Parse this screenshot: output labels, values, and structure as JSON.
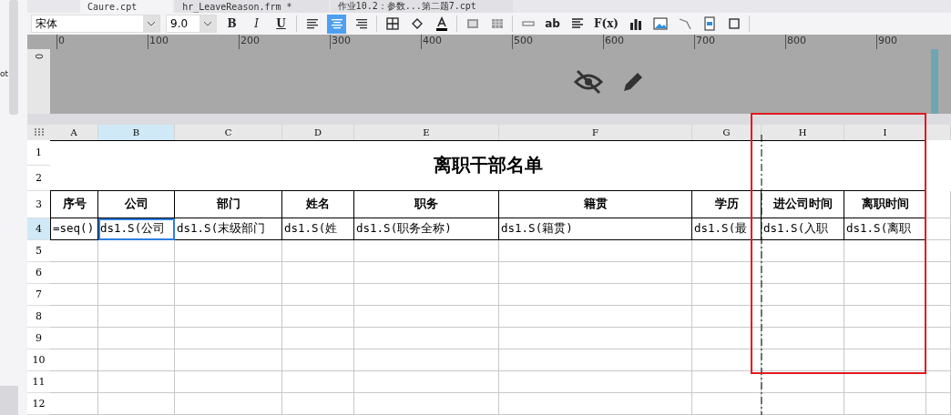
{
  "side_panel": {
    "label": "ot"
  },
  "tabs": [
    {
      "label": "Caure.cpt",
      "selected": true
    },
    {
      "label": "hr_LeaveReason.frm *",
      "selected": false
    },
    {
      "label": "作业10.2：参数...第二题7.cpt",
      "selected": false
    }
  ],
  "toolbar": {
    "font": "宋体",
    "size": "9.0",
    "styles": [
      "B",
      "I",
      "U"
    ],
    "align": [
      {
        "selected": false
      },
      {
        "selected": true
      },
      {
        "selected": false
      }
    ],
    "text_tools": [
      "ab",
      "F(x)"
    ]
  },
  "ruler": {
    "marks": [
      "0",
      "100",
      "200",
      "300",
      "400",
      "500",
      "600",
      "700",
      "800",
      "900"
    ],
    "vertical_mark": "0"
  },
  "sheet": {
    "columns": [
      {
        "label": "A",
        "selected": false
      },
      {
        "label": "B",
        "selected": true
      },
      {
        "label": "C",
        "selected": false
      },
      {
        "label": "D",
        "selected": false
      },
      {
        "label": "E",
        "selected": false
      },
      {
        "label": "F",
        "selected": false
      },
      {
        "label": "G",
        "selected": false
      },
      {
        "label": "H",
        "selected": false
      },
      {
        "label": "I",
        "selected": false
      }
    ],
    "rows": [
      {
        "label": "1",
        "selected": false
      },
      {
        "label": "2",
        "selected": false
      },
      {
        "label": "3",
        "selected": false
      },
      {
        "label": "4",
        "selected": true
      },
      {
        "label": "5",
        "selected": false
      },
      {
        "label": "6",
        "selected": false
      },
      {
        "label": "7",
        "selected": false
      },
      {
        "label": "8",
        "selected": false
      },
      {
        "label": "9",
        "selected": false
      },
      {
        "label": "10",
        "selected": false
      },
      {
        "label": "11",
        "selected": false
      },
      {
        "label": "12",
        "selected": false
      }
    ],
    "title": "离职干部名单",
    "headers": [
      "序号",
      "公司",
      "部门",
      "姓名",
      "职务",
      "籍贯",
      "学历",
      "进公司时间",
      "离职时间"
    ],
    "cells": [
      {
        "text": "=seq()",
        "selected": false
      },
      {
        "text": "ds1.S(公司",
        "selected": true
      },
      {
        "text": "ds1.S(末级部门",
        "selected": false
      },
      {
        "text": "ds1.S(姓",
        "selected": false
      },
      {
        "text": "ds1.S(职务全称)",
        "selected": false
      },
      {
        "text": "ds1.S(籍贯)",
        "selected": false
      },
      {
        "text": "ds1.S(最",
        "selected": false
      },
      {
        "text": "ds1.S(入职",
        "selected": false
      },
      {
        "text": "ds1.S(离职",
        "selected": false
      }
    ]
  }
}
